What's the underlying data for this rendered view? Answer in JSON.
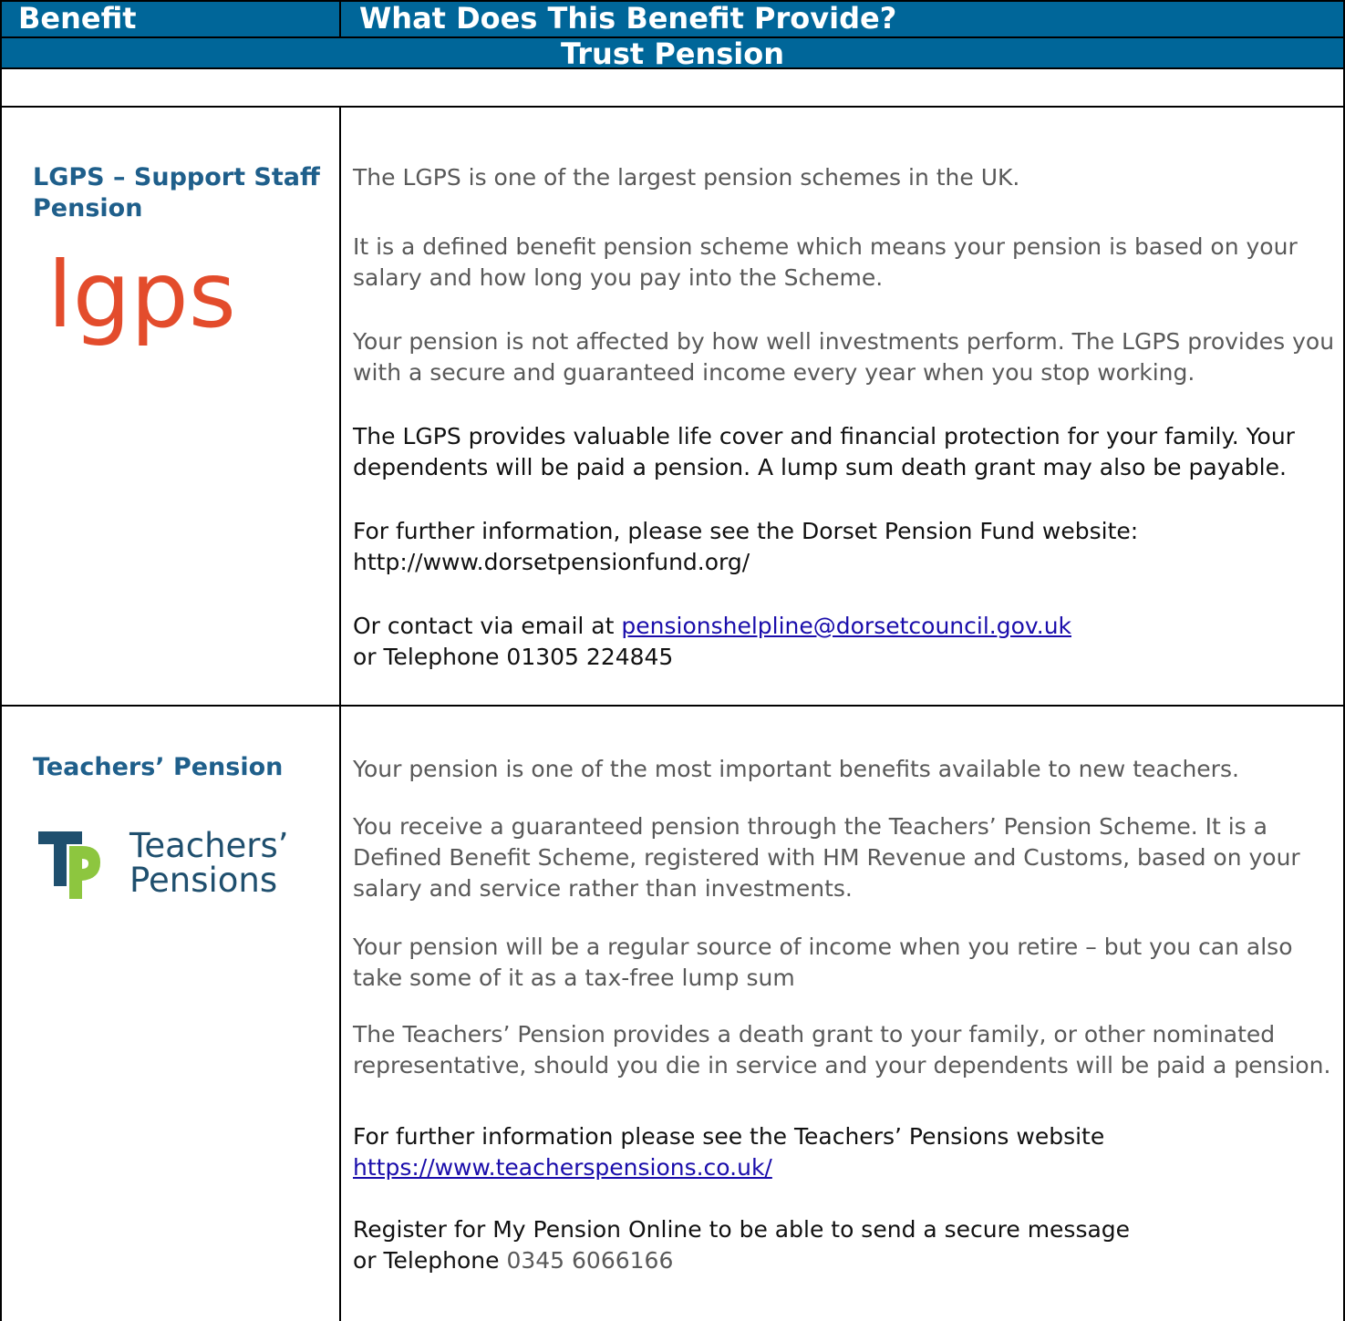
{
  "header": {
    "col_benefit": "Benefit",
    "col_provides": "What Does This Benefit Provide?",
    "section_title": "Trust Pension"
  },
  "lgps": {
    "title": "LGPS – Support Staff Pension",
    "logo_text": "lgps",
    "p1": "The LGPS is one of the largest pension schemes in the UK.",
    "p2": "It is a defined benefit pension scheme which means your pension is based on your salary and how long you pay into the Scheme.",
    "p3": "Your pension is not affected by how well investments perform. The LGPS provides you with a secure and guaranteed income every year when you stop working.",
    "p4": "The LGPS provides valuable life cover and financial protection for your family. Your dependents will be paid a pension. A lump sum death grant may also be payable.",
    "p5": "For further information, please see the Dorset Pension Fund website:",
    "url": "http://www.dorsetpensionfund.org/",
    "contact_prefix": "Or contact via email at ",
    "email": "pensionshelpline@dorsetcouncil.gov.uk",
    "phone": "or Telephone 01305 224845"
  },
  "teachers": {
    "title": "Teachers’ Pension",
    "logo_line1": "Teachers’",
    "logo_line2": "Pensions",
    "p1": "Your pension is one of the most important benefits available to new teachers.",
    "p2": "You receive a guaranteed pension through the Teachers’ Pension Scheme. It is a Defined Benefit Scheme, registered with HM Revenue and Customs, based on your salary and service rather than investments.",
    "p3": "Your pension will be a regular source of income when you retire – but you can also take some of it as a tax-free lump sum",
    "p4": "The Teachers’ Pension provides a death grant to your family, or other nominated representative, should you die in service and your dependents will be paid a pension.",
    "p5": "For further information please see the Teachers’ Pensions website",
    "url": "https://www.teacherspensions.co.uk/",
    "register": "Register for My Pension Online to be able to send a secure message",
    "phone_prefix": "or Telephone ",
    "phone_number": "0345 6066166"
  }
}
